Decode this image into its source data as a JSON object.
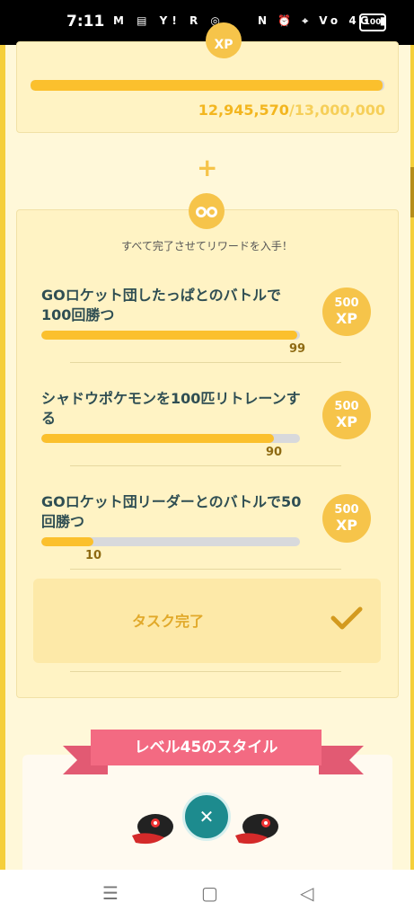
{
  "status_bar": {
    "time": "7:11",
    "left_icons": "M ▤ Y! R ◎",
    "right_icons": "N ⏰ ⌖ Vo 4G ▮",
    "battery": "100"
  },
  "xp_card": {
    "badge": "XP",
    "current": "12,945,570",
    "target": "/13,000,000",
    "progress_fraction": 0.9958
  },
  "plus_sign": "+",
  "tasks_card": {
    "instruction": "すべて完了させてリワードを入手！",
    "tasks": [
      {
        "title": "GOロケット団したっぱとのバトルで100回勝つ",
        "progress": 99,
        "max": 100,
        "xp_amount": "500",
        "xp_unit": "XP"
      },
      {
        "title": "シャドウポケモンを100匹リトレーンする",
        "progress": 90,
        "max": 100,
        "xp_amount": "500",
        "xp_unit": "XP"
      },
      {
        "title": "GOロケット団リーダーとのバトルで50回勝つ",
        "progress": 10,
        "max": 50,
        "xp_amount": "500",
        "xp_unit": "XP"
      }
    ],
    "complete_button": "タスク完了"
  },
  "style_section": {
    "title": "レベル45のスタイル"
  },
  "nav_bar": {
    "menu": "☰",
    "home": "▢",
    "back": "◁"
  },
  "colors": {
    "accent": "#fbc02d",
    "card_bg": "#fff3c4",
    "ribbon": "#f36a82",
    "teal": "#1d8b8e"
  }
}
